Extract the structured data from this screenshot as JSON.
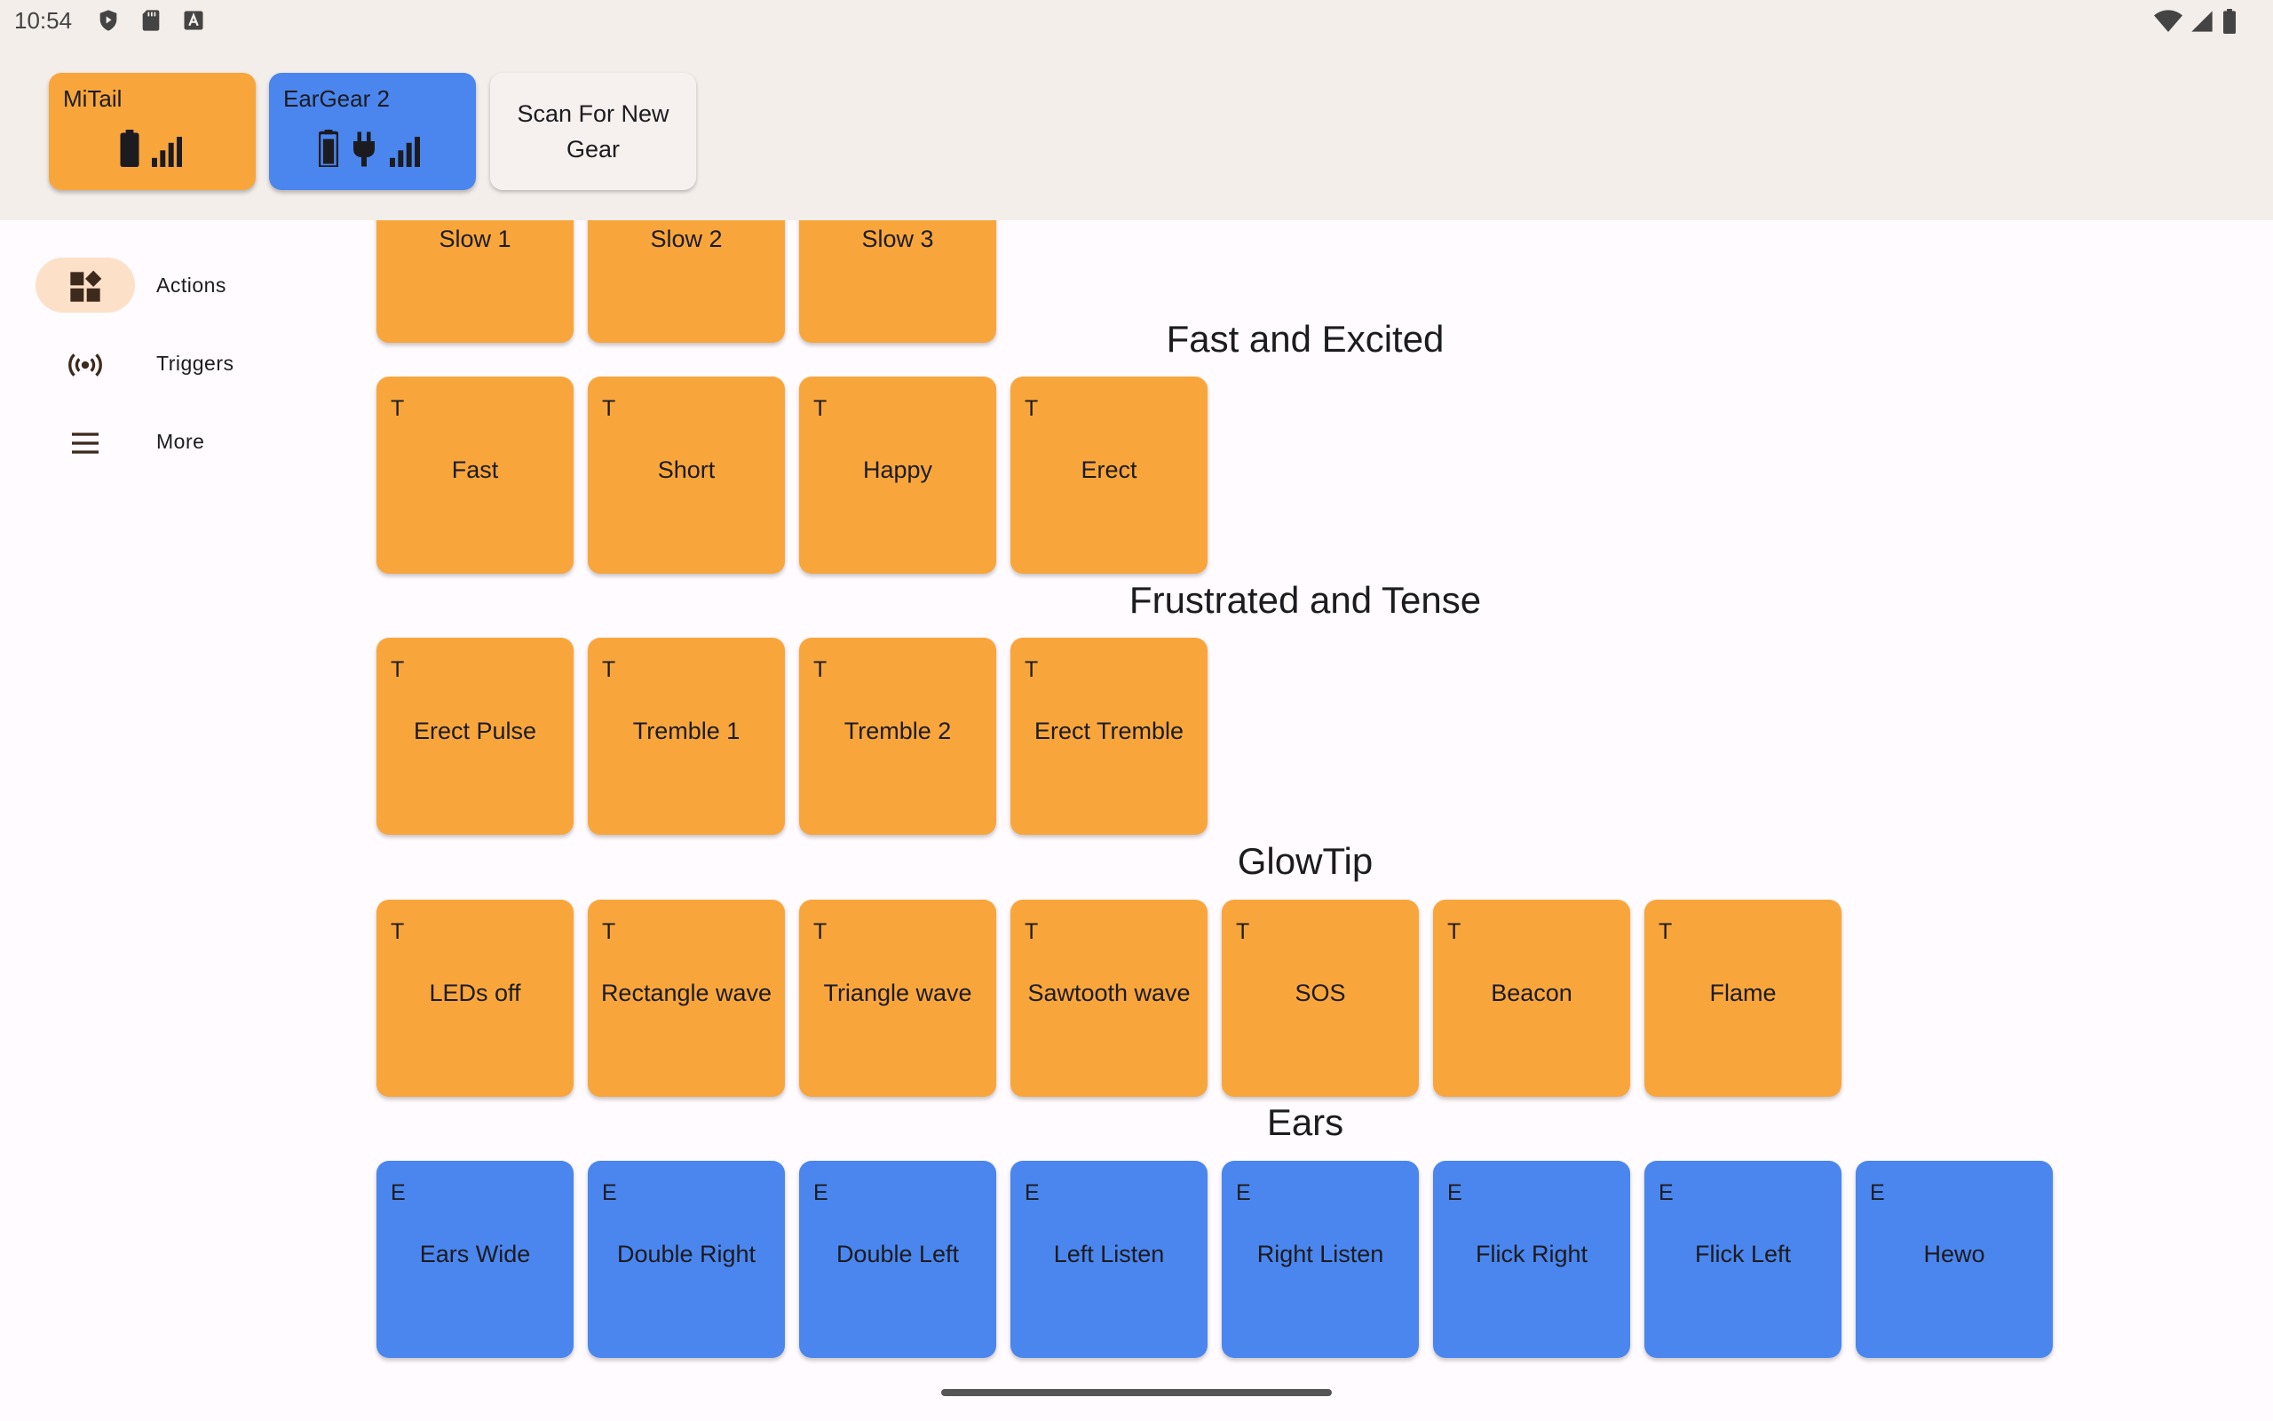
{
  "status_bar": {
    "time": "10:54",
    "icons_left": [
      "shield-play-icon",
      "sd-card-icon",
      "font-a-icon"
    ],
    "icons_right": [
      "wifi-icon",
      "cell-signal-icon",
      "battery-icon"
    ]
  },
  "gear": [
    {
      "name": "MiTail",
      "color": "#f8a63c",
      "icons": [
        "battery-icon",
        "signal-bars-icon"
      ]
    },
    {
      "name": "EarGear 2",
      "color": "#4a86ee",
      "icons": [
        "battery-icon",
        "charging-plug-icon",
        "signal-bars-icon"
      ]
    }
  ],
  "scan_button": {
    "label": "Scan For New Gear"
  },
  "nav": {
    "items": [
      {
        "label": "Actions",
        "icon": "dashboard-icon",
        "active": true
      },
      {
        "label": "Triggers",
        "icon": "broadcast-icon",
        "active": false
      },
      {
        "label": "More",
        "icon": "menu-icon",
        "active": false
      }
    ]
  },
  "sections": [
    {
      "title": "",
      "partial": true,
      "tiles": [
        {
          "badge": "",
          "label": "Slow 1",
          "color": "orange"
        },
        {
          "badge": "",
          "label": "Slow 2",
          "color": "orange"
        },
        {
          "badge": "",
          "label": "Slow 3",
          "color": "orange"
        }
      ]
    },
    {
      "title": "Fast and Excited",
      "tiles": [
        {
          "badge": "T",
          "label": "Fast",
          "color": "orange"
        },
        {
          "badge": "T",
          "label": "Short",
          "color": "orange"
        },
        {
          "badge": "T",
          "label": "Happy",
          "color": "orange"
        },
        {
          "badge": "T",
          "label": "Erect",
          "color": "orange"
        }
      ]
    },
    {
      "title": "Frustrated and Tense",
      "tiles": [
        {
          "badge": "T",
          "label": "Erect Pulse",
          "color": "orange"
        },
        {
          "badge": "T",
          "label": "Tremble 1",
          "color": "orange"
        },
        {
          "badge": "T",
          "label": "Tremble 2",
          "color": "orange"
        },
        {
          "badge": "T",
          "label": "Erect Tremble",
          "color": "orange"
        }
      ]
    },
    {
      "title": "GlowTip",
      "tiles": [
        {
          "badge": "T",
          "label": "LEDs off",
          "color": "orange"
        },
        {
          "badge": "T",
          "label": "Rectangle wave",
          "color": "orange"
        },
        {
          "badge": "T",
          "label": "Triangle wave",
          "color": "orange"
        },
        {
          "badge": "T",
          "label": "Sawtooth wave",
          "color": "orange"
        },
        {
          "badge": "T",
          "label": "SOS",
          "color": "orange"
        },
        {
          "badge": "T",
          "label": "Beacon",
          "color": "orange"
        },
        {
          "badge": "T",
          "label": "Flame",
          "color": "orange"
        }
      ]
    },
    {
      "title": "Ears",
      "tiles": [
        {
          "badge": "E",
          "label": "Ears Wide",
          "color": "blue"
        },
        {
          "badge": "E",
          "label": "Double Right",
          "color": "blue"
        },
        {
          "badge": "E",
          "label": "Double Left",
          "color": "blue"
        },
        {
          "badge": "E",
          "label": "Left Listen",
          "color": "blue"
        },
        {
          "badge": "E",
          "label": "Right Listen",
          "color": "blue"
        },
        {
          "badge": "E",
          "label": "Flick Right",
          "color": "blue"
        },
        {
          "badge": "E",
          "label": "Flick Left",
          "color": "blue"
        },
        {
          "badge": "E",
          "label": "Hewo",
          "color": "blue"
        }
      ]
    }
  ],
  "colors": {
    "orange": "#f8a63c",
    "blue": "#4a86ee",
    "header_bg": "#f4eeea",
    "nav_active": "#fce0c8"
  }
}
